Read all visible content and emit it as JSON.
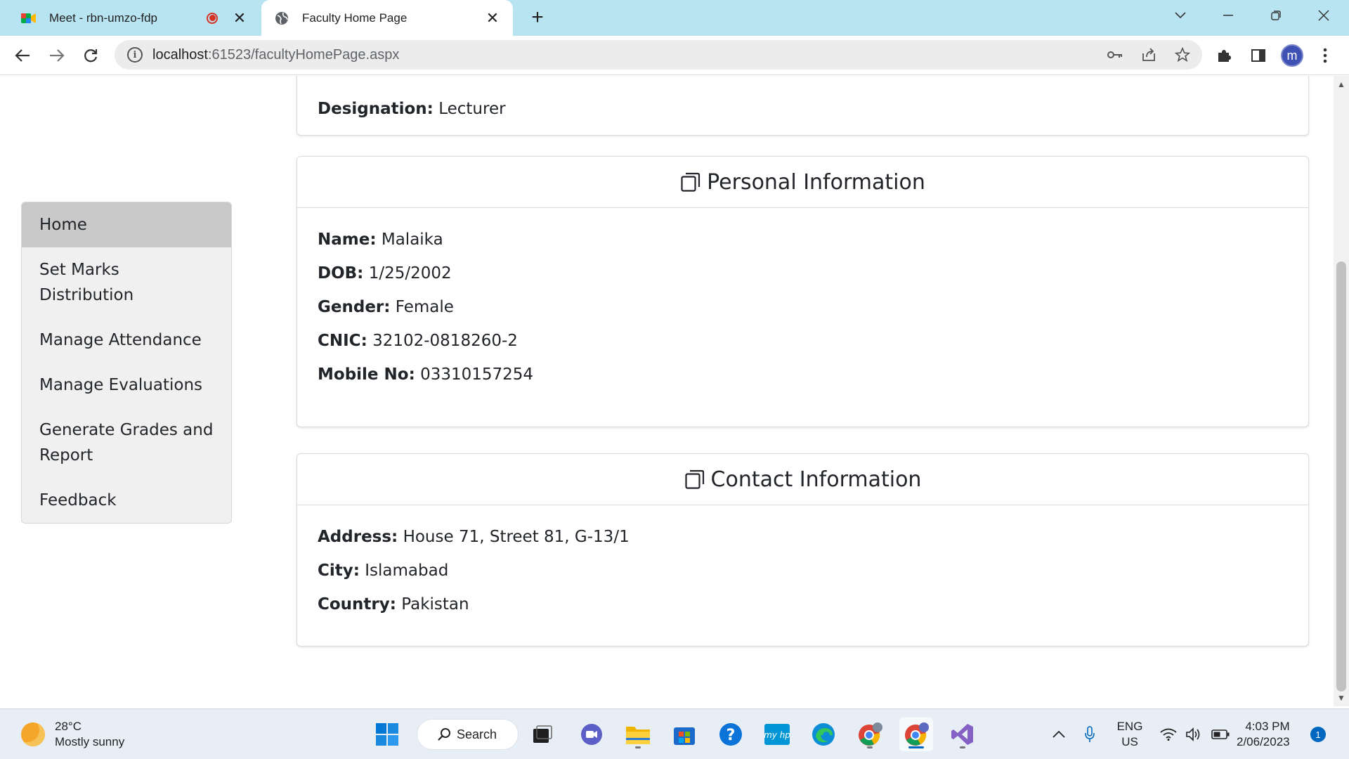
{
  "browser": {
    "tabs": [
      {
        "title": "Meet - rbn-umzo-fdp",
        "icon": "google-meet-icon",
        "recording": true
      },
      {
        "title": "Faculty Home Page",
        "icon": "globe-icon",
        "active": true
      }
    ],
    "url_host": "localhost",
    "url_rest": ":61523/facultyHomePage.aspx",
    "profile_initial": "m"
  },
  "sidebar": {
    "items": [
      {
        "label": "Home",
        "active": true
      },
      {
        "label": "Set Marks Distribution"
      },
      {
        "label": "Manage Attendance"
      },
      {
        "label": "Manage Evaluations"
      },
      {
        "label": "Generate Grades and Report"
      },
      {
        "label": "Feedback"
      }
    ]
  },
  "designation": {
    "label": "Designation:",
    "value": "Lecturer"
  },
  "personal": {
    "title": "Personal Information",
    "fields": [
      {
        "label": "Name:",
        "value": "Malaika"
      },
      {
        "label": "DOB:",
        "value": "1/25/2002"
      },
      {
        "label": "Gender:",
        "value": "Female"
      },
      {
        "label": "CNIC:",
        "value": "32102-0818260-2"
      },
      {
        "label": "Mobile No:",
        "value": "03310157254"
      }
    ]
  },
  "contact": {
    "title": "Contact Information",
    "fields": [
      {
        "label": "Address:",
        "value": "House 71, Street 81, G-13/1"
      },
      {
        "label": "City:",
        "value": "Islamabad"
      },
      {
        "label": "Country:",
        "value": "Pakistan"
      }
    ]
  },
  "taskbar": {
    "weather_temp": "28°C",
    "weather_desc": "Mostly sunny",
    "search_label": "Search",
    "lang_top": "ENG",
    "lang_bottom": "US",
    "time": "4:03 PM",
    "date": "2/06/2023",
    "notification_count": "1"
  },
  "colors": {
    "tab_strip": "#b8e4f2",
    "sidebar_active": "#c9c9c9",
    "sidebar_bg": "#f0f0f0",
    "accent": "#0067c0"
  }
}
